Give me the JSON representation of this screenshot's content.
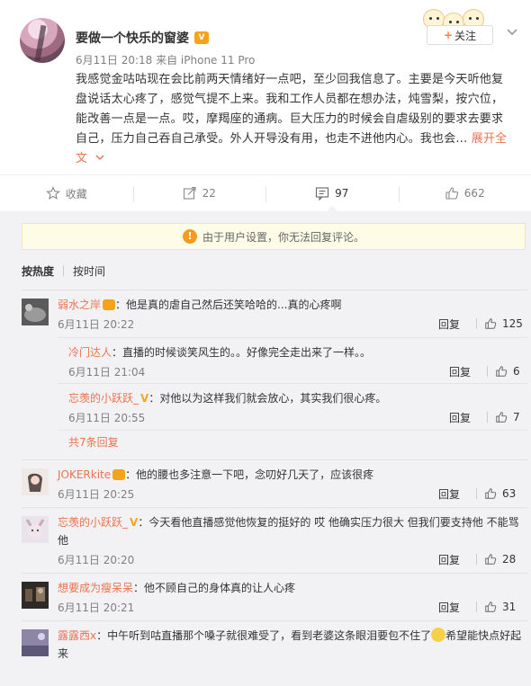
{
  "post": {
    "author": "要做一个快乐的窗婆",
    "meta": "6月11日 20:18 来自 iPhone 11 Pro",
    "text": "我感觉金咕咕现在会比前两天情绪好一点吧，至少回我信息了。主要是今天听他复盘说话太心疼了，感觉气提不上来。我和工作人员都在想办法，炖雪梨，按穴位，能改善一点是一点。哎，摩羯座的通病。巨大压力的时候会自虐级别的要求去要求自己，压力自己吞自己承受。外人开导没有用，也走不进他内心。我也会",
    "ellipsis": "... ",
    "expand_label": "展开全文",
    "follow_label": "关注"
  },
  "actions": {
    "favorite_label": "收藏",
    "repost_count": "22",
    "comment_count": "97",
    "like_count": "662"
  },
  "notice": "由于用户设置，你无法回复评论。",
  "sort": {
    "hot": "按热度",
    "time": "按时间"
  },
  "comments": [
    {
      "user": "弱水之岸",
      "text": "：他是真的虐自己然后还笑哈哈的...真的心疼啊",
      "time": "6月11日 20:22",
      "reply": "回复",
      "likes": "125",
      "subs": [
        {
          "user": "冷门达人",
          "text": "：直播的时候谈笑风生的。。好像完全走出来了一样。。",
          "time": "6月11日 21:04",
          "reply": "回复",
          "likes": "6"
        },
        {
          "user": "忘羡的小跃跃_",
          "text": "：对他以为这样我们就会放心，其实我们很心疼。",
          "time": "6月11日 20:55",
          "reply": "回复",
          "likes": "7"
        }
      ],
      "more": "共7条回复"
    },
    {
      "user": "JOKERkite",
      "text": "：他的腰也多注意一下吧，念叨好几天了，应该很疼",
      "time": "6月11日 20:25",
      "reply": "回复",
      "likes": "63"
    },
    {
      "user": "忘羡的小跃跃_",
      "text": "：今天看他直播感觉他恢复的挺好的 哎 他确实压力很大 但我们要支持他 不能骂他",
      "time": "6月11日 20:20",
      "reply": "回复",
      "likes": "28"
    },
    {
      "user": "想要成为瘦呆呆",
      "text": "：他不顾自己的身体真的让人心疼",
      "time": "6月11日 20:21",
      "reply": "回复",
      "likes": "31"
    },
    {
      "user": "露露西x",
      "text": "：中午听到咕直播那个嗓子就很难受了，看到老婆这条眼泪要包不住了",
      "text2": "希望能快点好起来"
    }
  ]
}
